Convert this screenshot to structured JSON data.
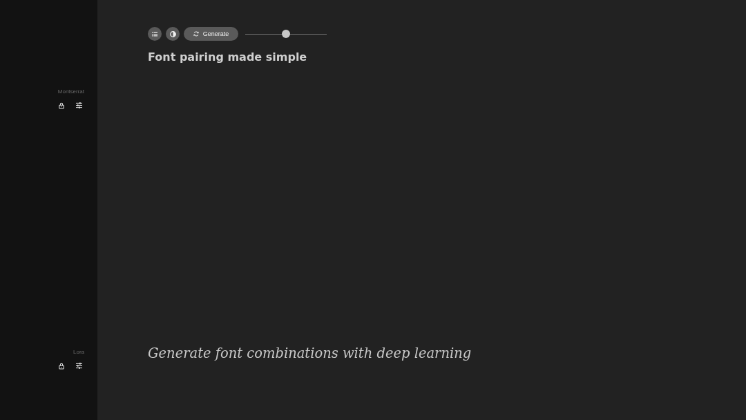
{
  "sidebar": {
    "fonts": [
      {
        "name": "Montserrat"
      },
      {
        "name": "Lora"
      }
    ]
  },
  "toolbar": {
    "generate_button": {
      "label": "Generate"
    },
    "slider": {
      "level": 0.5
    }
  },
  "heading": "Font pairing made simple",
  "body_text": "Generate font combinations with deep learning"
}
